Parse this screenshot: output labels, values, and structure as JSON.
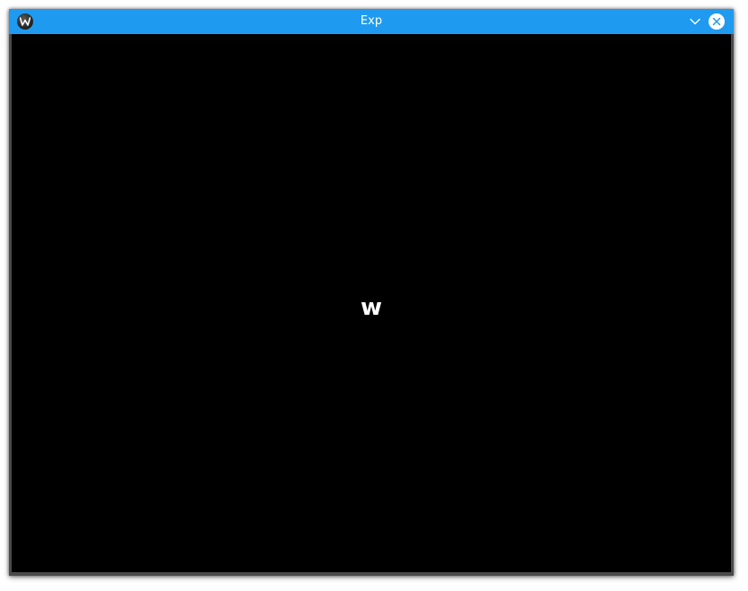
{
  "window": {
    "title": "Exp",
    "titlebar_color": "#1e9bf0",
    "app_icon": "kde-app-icon",
    "controls": {
      "minimize_icon": "chevron-down-icon",
      "close_icon": "close-icon"
    }
  },
  "content": {
    "background": "#000000",
    "label": "w"
  }
}
